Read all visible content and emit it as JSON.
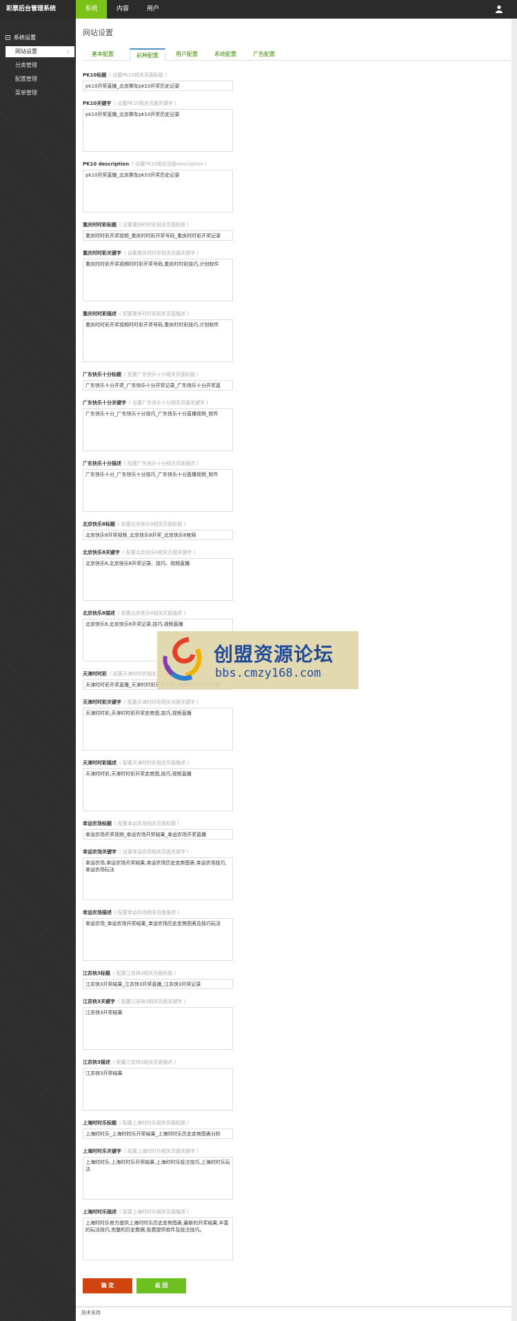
{
  "header": {
    "brand": "彩票后台管理系统",
    "nav": [
      "系统",
      "内容",
      "用户"
    ],
    "user_icon": "user-icon"
  },
  "sidebar": {
    "section": "系统设置",
    "items": [
      {
        "label": "网站设置"
      },
      {
        "label": "分类管理"
      },
      {
        "label": "配置管理"
      },
      {
        "label": "菜单管理"
      }
    ]
  },
  "main": {
    "title": "网站设置",
    "tabs": [
      "基本配置",
      "彩种配置",
      "用户配置",
      "系统配置",
      "广告配置"
    ]
  },
  "fields": [
    {
      "label": "PK10标题",
      "hint": "( 设置PK10相关页面标题 )",
      "value": "pk10开奖直播_北京赛车pk10开奖历史记录",
      "type": "input"
    },
    {
      "label": "PK10关键字",
      "hint": "( 设置PK10相关页面关键字 )",
      "value": "pk10开奖直播_北京赛车pk10开奖历史记录",
      "type": "area"
    },
    {
      "label": "PK10 description",
      "hint": "( 设置PK10相关页面description )",
      "value": "pk10开奖直播_北京赛车pk10开奖历史记录",
      "type": "area"
    },
    {
      "label": "重庆时时彩标题",
      "hint": "( 设置重庆时时彩相关页面标题 )",
      "value": "重庆时时彩开奖视频_重庆时时彩开奖号码_重庆时时彩开奖记录",
      "type": "input"
    },
    {
      "label": "重庆时时彩关键字",
      "hint": "( 设置重庆时时彩相关页面关键字 )",
      "value": "重庆时时彩开奖视频时时彩开奖号码,重庆时时彩技巧,计划软件",
      "type": "area"
    },
    {
      "label": "重庆时时彩描述",
      "hint": "( 配置重庆时时彩相关页面描述 )",
      "value": "重庆时时彩开奖视频时时彩开奖号码,重庆时时彩技巧,计划软件",
      "type": "area"
    },
    {
      "label": "广东快乐十分标题",
      "hint": "( 配置广东快乐十分相关页面标题 )",
      "value": "广东快乐十分开奖_广东快乐十分开奖记录_广东快乐十分开奖直",
      "type": "input"
    },
    {
      "label": "广东快乐十分关键字",
      "hint": "( 设置广东快乐十分相关页面关键字 )",
      "value": "广东快乐十分_广东快乐十分技巧_广东快乐十分直播视频_软件",
      "type": "area"
    },
    {
      "label": "广东快乐十分描述",
      "hint": "( 配置广东快乐十分相关页面描述 )",
      "value": "广东快乐十分_广东快乐十分技巧_广东快乐十分直播视频_软件",
      "type": "area"
    },
    {
      "label": "北京快乐8标题",
      "hint": "( 配置北京快乐8相关页面标题 )",
      "value": "北京快乐8开奖视频_北京快乐8开奖_北京快乐8官网",
      "type": "input"
    },
    {
      "label": "北京快乐8关键字",
      "hint": "( 配置北京快乐8相关页面关键字 )",
      "value": "北京快乐8,北京快乐8开奖记录、技巧、视频直播",
      "type": "area"
    },
    {
      "label": "北京快乐8描述",
      "hint": "( 配置北京快乐8相关页面描述 )",
      "value": "北京快乐8,北京快乐8开奖记录,技巧,视频直播",
      "type": "area"
    },
    {
      "label": "天津时时彩",
      "hint": "( 配置天津时时彩相关页面标题 )",
      "value": "天津时时彩开奖直播_天津时时彩开奖号码_天津时时彩开奖记录",
      "type": "input"
    },
    {
      "label": "天津时时彩关键字",
      "hint": "( 配置天津时时彩相关页面关键字 )",
      "value": "天津时时彩,天津时时彩开奖走势图,技巧,视频直播",
      "type": "area"
    },
    {
      "label": "天津时时彩描述",
      "hint": "( 配置天津时时彩相关页面描述 )",
      "value": "天津时时彩,天津时时彩开奖走势图,技巧,视频直播",
      "type": "area"
    },
    {
      "label": "幸运农场标题",
      "hint": "( 配置幸运农场相关页面标题 )",
      "value": "幸运农场开奖视频_幸运农场开奖结果_幸运农场开奖直播",
      "type": "input"
    },
    {
      "label": "幸运农场关键字",
      "hint": "( 设置幸运农场相关页面关键字 )",
      "value": "幸运农场,幸运农场开奖结果,幸运农场历史走势图表,幸运农场技巧,幸运农场玩法",
      "type": "area"
    },
    {
      "label": "幸运农场描述",
      "hint": "( 配置幸运农场相关页面描述 )",
      "value": "幸运农场_幸运农场开奖结果_幸运农场历史走势图表及技巧玩法",
      "type": "area"
    },
    {
      "label": "江苏快3标题",
      "hint": "( 配置江苏快3相关页面标题 )",
      "value": "江苏快3开奖结果_江苏快3开奖直播_江苏快3开奖记录",
      "type": "input"
    },
    {
      "label": "江苏快3关键字",
      "hint": "( 配置江苏快3相关页面关键字 )",
      "value": "江苏快3开奖结果",
      "type": "area"
    },
    {
      "label": "江苏快3描述",
      "hint": "( 配置江苏快3相关页面描述 )",
      "value": "江苏快3开奖结果",
      "type": "area"
    },
    {
      "label": "上海时时乐标题",
      "hint": "( 配置上海时时乐相关页面标题 )",
      "value": "上海时时乐_上海时时乐开奖结果_上海时时乐历史走势图表分析",
      "type": "input"
    },
    {
      "label": "上海时时乐关键字",
      "hint": "( 配置上海时时乐相关页面关键字 )",
      "value": "上海时时乐,上海时时乐开奖结果,上海时时乐投注技巧,上海时时乐玩法",
      "type": "area"
    },
    {
      "label": "上海时时乐描述",
      "hint": "( 配置上海时时乐相关页面描述 )",
      "value": "上海时时乐官方提供上海时时乐历史走势图表,最新的开奖结果,丰富的玩法技巧,完整的历史数据,免费提供软件及投注技巧。",
      "type": "area"
    }
  ],
  "buttons": {
    "confirm": "确 定",
    "back": "返 回"
  },
  "footer": {
    "text": "技术支持"
  },
  "watermark": {
    "title": "创盟资源论坛",
    "url": "bbs.cmzy168.com"
  },
  "colors": {
    "nav_active": "#7bc118",
    "confirm": "#d2440f",
    "back": "#6cc120",
    "tab_text": "#3a8a00"
  }
}
